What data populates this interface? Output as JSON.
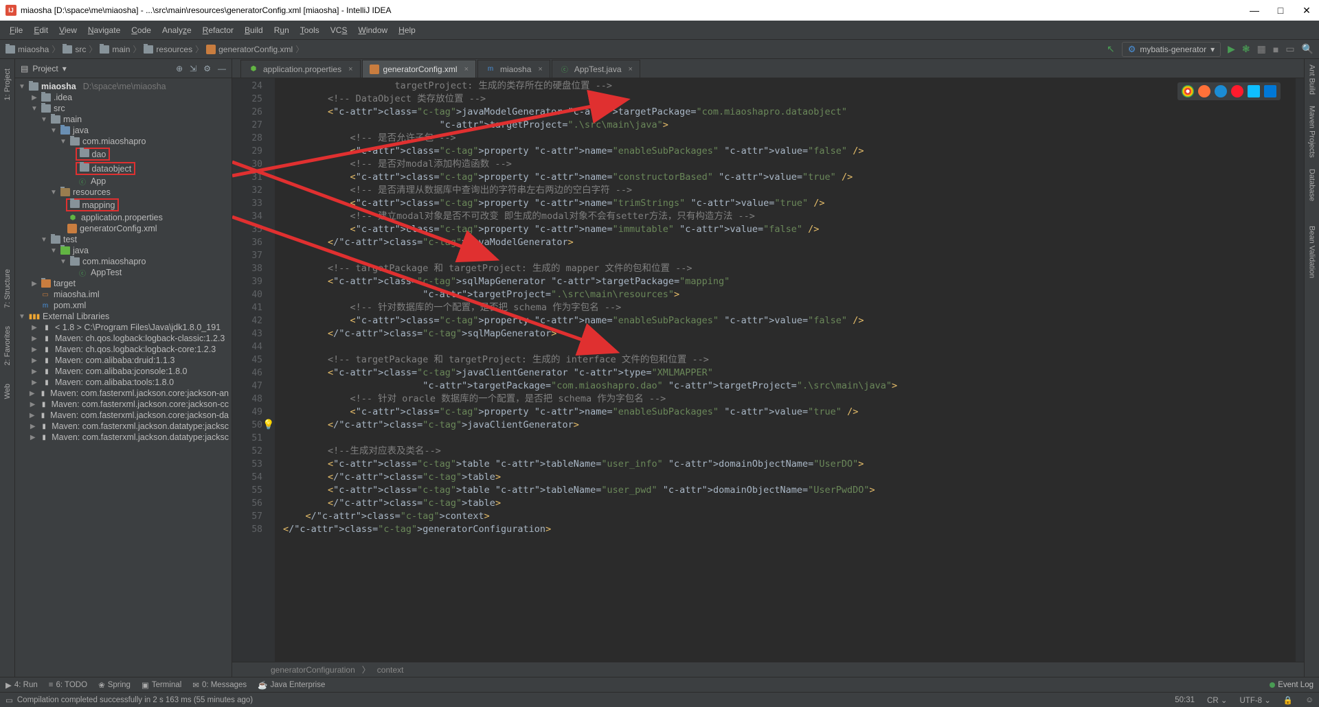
{
  "title": "miaosha [D:\\space\\me\\miaosha] - ...\\src\\main\\resources\\generatorConfig.xml [miaosha] - IntelliJ IDEA",
  "menus": [
    "File",
    "Edit",
    "View",
    "Navigate",
    "Code",
    "Analyze",
    "Refactor",
    "Build",
    "Run",
    "Tools",
    "VCS",
    "Window",
    "Help"
  ],
  "breadcrumbs": [
    "miaosha",
    "src",
    "main",
    "resources",
    "generatorConfig.xml"
  ],
  "run_config": "mybatis-generator",
  "project_panel": {
    "title": "Project",
    "dropdown": "▾"
  },
  "tree": {
    "root": "miaosha",
    "root_hint": "D:\\space\\me\\miaosha",
    "items": [
      ".idea",
      "src",
      "main",
      "java",
      "com.miaoshapro",
      "dao",
      "dataobject",
      "App",
      "resources",
      "mapping",
      "application.properties",
      "generatorConfig.xml",
      "test",
      "java",
      "com.miaoshapro",
      "AppTest",
      "target",
      "miaosha.iml",
      "pom.xml",
      "External Libraries"
    ],
    "libs": [
      "< 1.8 >  C:\\Program Files\\Java\\jdk1.8.0_191",
      "Maven: ch.qos.logback:logback-classic:1.2.3",
      "Maven: ch.qos.logback:logback-core:1.2.3",
      "Maven: com.alibaba:druid:1.1.3",
      "Maven: com.alibaba:jconsole:1.8.0",
      "Maven: com.alibaba:tools:1.8.0",
      "Maven: com.fasterxml.jackson.core:jackson-an",
      "Maven: com.fasterxml.jackson.core:jackson-cc",
      "Maven: com.fasterxml.jackson.core:jackson-da",
      "Maven: com.fasterxml.jackson.datatype:jacksc",
      "Maven: com.fasterxml.jackson.datatype:jacksc"
    ]
  },
  "tabs": [
    {
      "label": "application.properties",
      "active": false
    },
    {
      "label": "generatorConfig.xml",
      "active": true
    },
    {
      "label": "miaosha",
      "active": false
    },
    {
      "label": "AppTest.java",
      "active": false
    }
  ],
  "code_start_line": 24,
  "code_lines": [
    {
      "t": "cmt",
      "v": "                    targetProject: 生成的类存所在的硬盘位置 -->"
    },
    {
      "t": "cmt",
      "v": "        <!-- DataObject 类存放位置 -->"
    },
    {
      "t": "xml",
      "v": "        <javaModelGenerator targetPackage=\"com.miaoshapro.dataobject\""
    },
    {
      "t": "xml",
      "v": "                            targetProject=\".\\src\\main\\java\">"
    },
    {
      "t": "cmt",
      "v": "            <!-- 是否允许子包 -->"
    },
    {
      "t": "xml",
      "v": "            <property name=\"enableSubPackages\" value=\"false\" />"
    },
    {
      "t": "cmt",
      "v": "            <!-- 是否对modal添加构造函数 -->"
    },
    {
      "t": "xml",
      "v": "            <property name=\"constructorBased\" value=\"true\" />"
    },
    {
      "t": "cmt",
      "v": "            <!-- 是否清理从数据库中查询出的字符串左右两边的空白字符 -->"
    },
    {
      "t": "xml",
      "v": "            <property name=\"trimStrings\" value=\"true\" />"
    },
    {
      "t": "cmt",
      "v": "            <!-- 建立modal对象是否不可改变 即生成的modal对象不会有setter方法，只有构造方法 -->"
    },
    {
      "t": "xml",
      "v": "            <property name=\"immutable\" value=\"false\" />"
    },
    {
      "t": "xml",
      "v": "        </javaModelGenerator>"
    },
    {
      "t": "txt",
      "v": ""
    },
    {
      "t": "cmt",
      "v": "        <!-- targetPackage 和 targetProject: 生成的 mapper 文件的包和位置 -->"
    },
    {
      "t": "xml",
      "v": "        <sqlMapGenerator targetPackage=\"mapping\""
    },
    {
      "t": "xml",
      "v": "                         targetProject=\".\\src\\main\\resources\">"
    },
    {
      "t": "cmt",
      "v": "            <!-- 针对数据库的一个配置，是否把 schema 作为字包名 -->"
    },
    {
      "t": "xml",
      "v": "            <property name=\"enableSubPackages\" value=\"false\" />"
    },
    {
      "t": "xml",
      "v": "        </sqlMapGenerator>"
    },
    {
      "t": "txt",
      "v": ""
    },
    {
      "t": "cmt",
      "v": "        <!-- targetPackage 和 targetProject: 生成的 interface 文件的包和位置 -->"
    },
    {
      "t": "xml",
      "v": "        <javaClientGenerator type=\"XMLMAPPER\""
    },
    {
      "t": "xml",
      "v": "                         targetPackage=\"com.miaoshapro.dao\" targetProject=\".\\src\\main\\java\">"
    },
    {
      "t": "cmt",
      "v": "            <!-- 针对 oracle 数据库的一个配置，是否把 schema 作为字包名 -->"
    },
    {
      "t": "xml",
      "v": "            <property name=\"enableSubPackages\" value=\"true\" />"
    },
    {
      "t": "xml",
      "v": "        </javaClientGenerator>"
    },
    {
      "t": "txt",
      "v": ""
    },
    {
      "t": "cmt",
      "v": "        <!--生成对应表及类名-->"
    },
    {
      "t": "xml",
      "v": "        <table tableName=\"user_info\" domainObjectName=\"UserDO\">"
    },
    {
      "t": "xml",
      "v": "        </table>"
    },
    {
      "t": "xml",
      "v": "        <table tableName=\"user_pwd\" domainObjectName=\"UserPwdDO\">"
    },
    {
      "t": "xml",
      "v": "        </table>"
    },
    {
      "t": "xml",
      "v": "    </context>"
    },
    {
      "t": "xml",
      "v": "</generatorConfiguration>"
    }
  ],
  "editor_breadcrumb": [
    "generatorConfiguration",
    "context"
  ],
  "bottom_tabs": [
    "4: Run",
    "6: TODO",
    "Spring",
    "Terminal",
    "0: Messages",
    "Java Enterprise"
  ],
  "event_log": "Event Log",
  "status_msg": "Compilation completed successfully in 2 s 163 ms (55 minutes ago)",
  "status_right": {
    "pos": "50:31",
    "cr": "CR",
    "enc": "UTF-8"
  },
  "left_gutter_tabs": [
    "1: Project",
    "7: Structure",
    "2: Favorites",
    "Web"
  ],
  "right_gutter_tabs": [
    "Ant Build",
    "Maven Projects",
    "Database",
    "Bean Validation"
  ]
}
